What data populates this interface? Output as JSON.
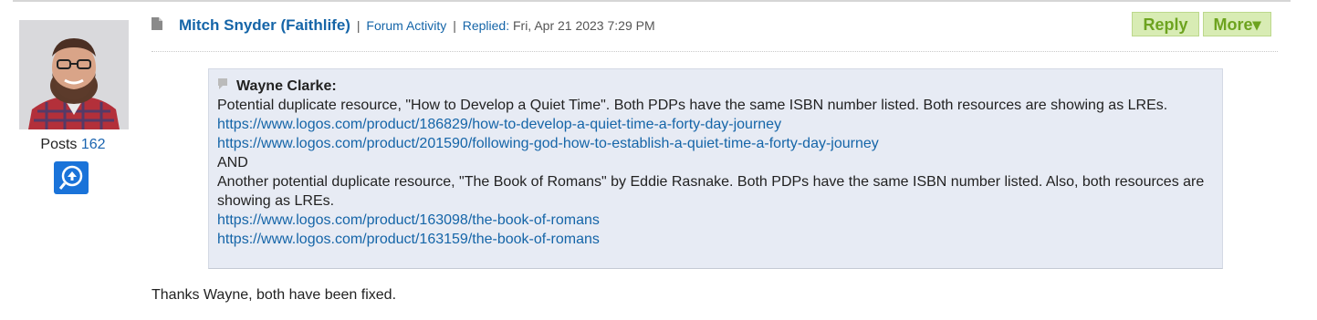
{
  "author": {
    "name": "Mitch Snyder (Faithlife)",
    "posts_label": "Posts",
    "posts_count": "162"
  },
  "header": {
    "forum_activity": "Forum Activity",
    "replied_label": "Replied:",
    "date": "Fri, Apr 21 2023 7:29 PM"
  },
  "buttons": {
    "reply": "Reply",
    "more": "More▾"
  },
  "quote": {
    "author": "Wayne Clarke:",
    "line1": "Potential duplicate resource, \"How to Develop a Quiet Time\".  Both PDPs have the same ISBN number listed.  Both resources are showing as LREs.",
    "link1": "https://www.logos.com/product/186829/how-to-develop-a-quiet-time-a-forty-day-journey",
    "link2": "https://www.logos.com/product/201590/following-god-how-to-establish-a-quiet-time-a-forty-day-journey",
    "and": "AND",
    "line2": "Another potential duplicate resource, \"The Book of Romans\" by Eddie Rasnake.  Both PDPs have the same ISBN number listed.  Also, both resources are showing as LREs.",
    "link3": "https://www.logos.com/product/163098/the-book-of-romans",
    "link4": "https://www.logos.com/product/163159/the-book-of-romans"
  },
  "reply_text": "Thanks Wayne, both have been fixed.",
  "colors": {
    "link": "#1565a8",
    "button_bg": "#d8ecb4",
    "button_text": "#6da31f",
    "quote_bg": "#e7ebf4",
    "badge": "#1a73d9"
  }
}
